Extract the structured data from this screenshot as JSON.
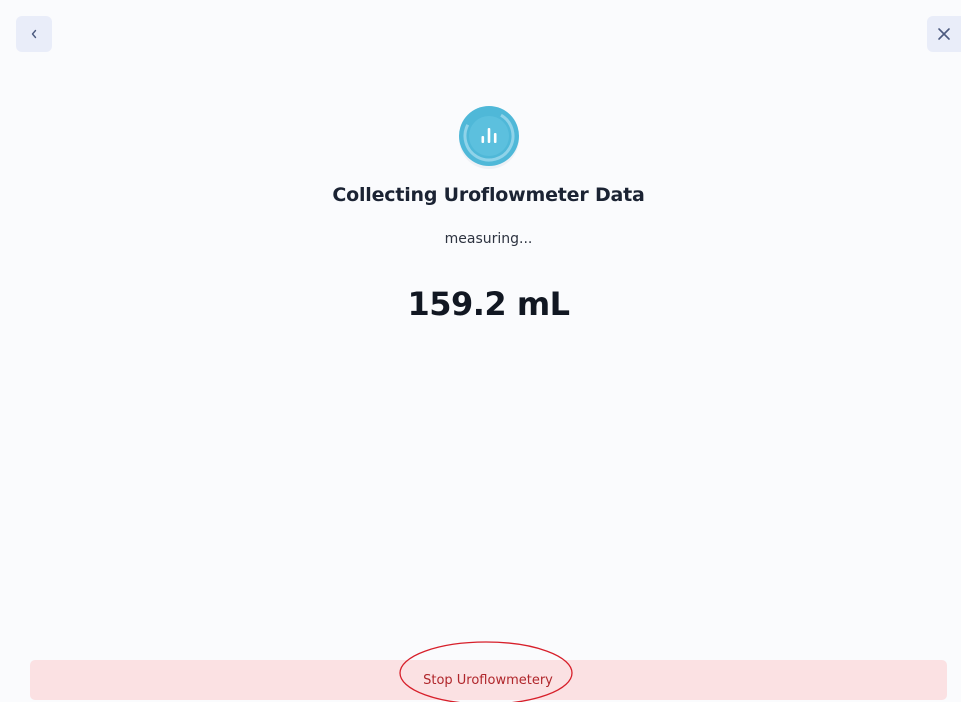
{
  "header": {
    "back_icon": "chevron-left-icon",
    "close_icon": "close-icon"
  },
  "status": {
    "icon": "bar-chart-icon",
    "title": "Collecting Uroflowmeter Data",
    "subtitle": "measuring...",
    "volume": "159.2 mL"
  },
  "footer": {
    "stop_label": "Stop Uroflowmetery"
  },
  "colors": {
    "accent": "#4fb8d8",
    "stop_background": "#fbe1e3",
    "stop_text": "#b0262b",
    "annotation": "#d71f2a"
  }
}
